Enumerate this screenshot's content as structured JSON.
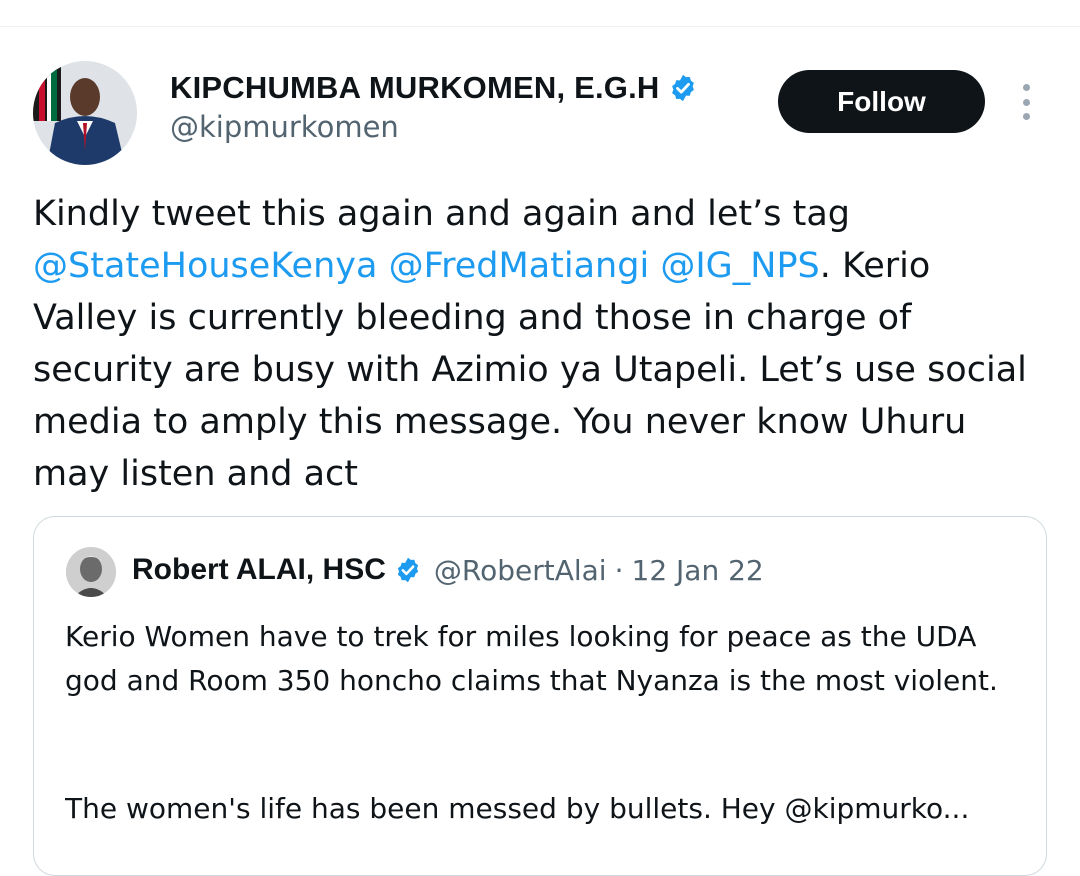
{
  "author": {
    "display_name": "KIPCHUMBA MURKOMEN, E.G.H",
    "handle": "@kipmurkomen",
    "avatar": "avatar-photo",
    "verified_icon": "verified-badge-icon"
  },
  "follow_button": {
    "label": "Follow"
  },
  "more_menu": {
    "icon": "more-vertical-icon"
  },
  "tweet": {
    "text_1": "Kindly tweet this again and again and let’s tag ",
    "mention_1": "@StateHouseKenya",
    "text_2": " ",
    "mention_2": "@FredMatiangi",
    "text_3": " ",
    "mention_3": "@IG_NPS",
    "text_4": ". Kerio Valley is currently bleeding and those in charge of security are busy with Azimio ya Utapeli. Let’s use social media to amply this message. You never know Uhuru may listen and act"
  },
  "quoted": {
    "display_name": "Robert ALAI, HSC",
    "handle": "@RobertAlai",
    "separator": "·",
    "date": "12 Jan 22",
    "text_1": "Kerio Women have to trek for miles looking for peace as the UDA god and Room 350 honcho claims that Nyanza is the most violent.",
    "text_2": "The women's life has been messed by bullets. Hey @kipmurko..."
  },
  "colors": {
    "link": "#1d9bf0",
    "text": "#0f1419",
    "secondary": "#536471",
    "button_bg": "#0f1419",
    "border": "#cfd9de"
  }
}
